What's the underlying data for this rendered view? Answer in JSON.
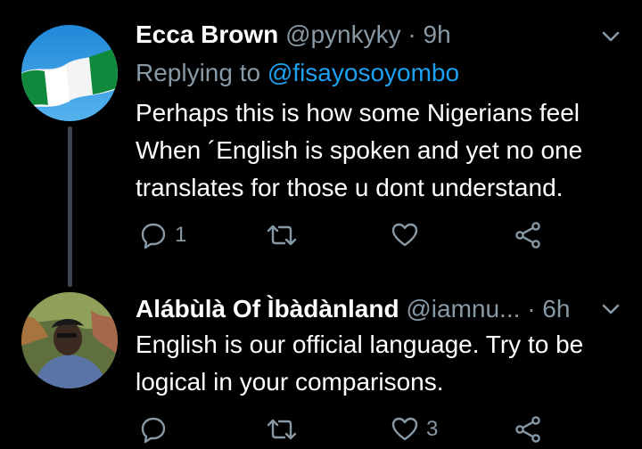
{
  "tweets": [
    {
      "display_name": "Ecca Brown",
      "handle": "@pynkyky",
      "separator": "·",
      "time": "9h",
      "replying_label": "Replying to",
      "replying_to": "@fisayosoyombo",
      "lines": [
        "Perhaps this is how some Nigerians feel",
        "When ´English is spoken and yet no one",
        "translates for those u dont understand."
      ],
      "reply_count": "1",
      "retweet_count": "",
      "like_count": ""
    },
    {
      "display_name": "Alábùlà Of Ìbàdànland",
      "handle": "@iamnu...",
      "separator": "·",
      "time": "6h",
      "lines": [
        "English is our official language. Try to be",
        "logical in your comparisons."
      ],
      "reply_count": "",
      "retweet_count": "",
      "like_count": "3"
    }
  ],
  "icons": {
    "reply": "reply-icon",
    "retweet": "retweet-icon",
    "like": "like-icon",
    "share": "share-icon",
    "more": "chevron-down-icon"
  },
  "colors": {
    "background": "#000000",
    "primary_text": "#ffffff",
    "secondary_text": "#8899a6",
    "link": "#1da1f2",
    "thread_line": "#3a4652",
    "icon": "#8899a6"
  }
}
